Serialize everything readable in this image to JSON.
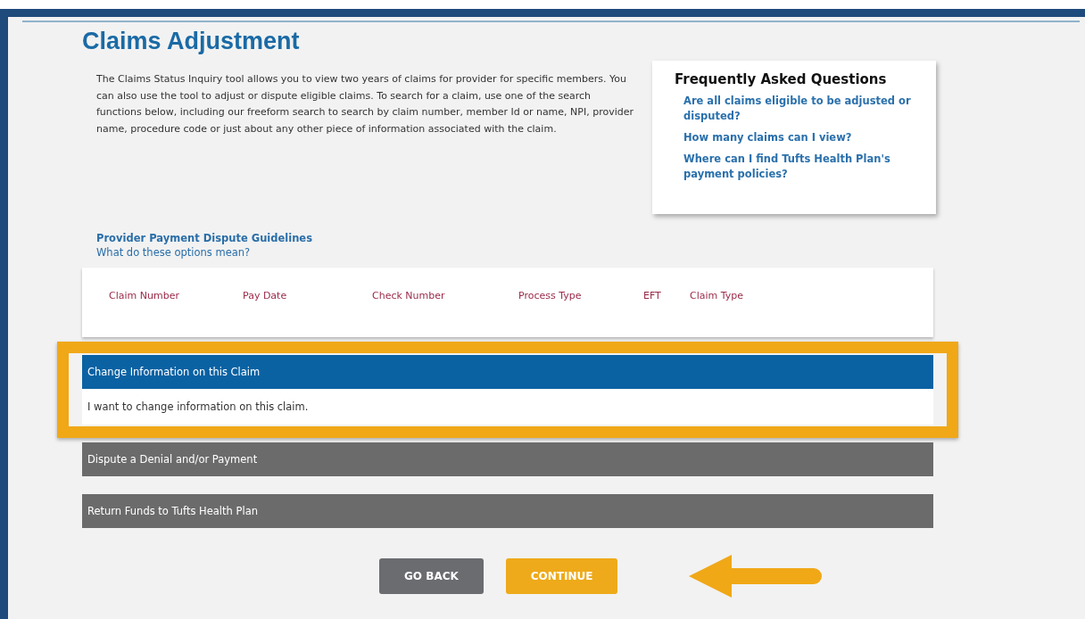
{
  "page": {
    "title": "Claims Adjustment",
    "intro": "The Claims Status Inquiry tool allows you to view two years of claims for provider for specific members. You can also use the tool to adjust or dispute eligible claims. To search for a claim, use one of the search functions below, including our freeform search to search by claim number, member Id or name, NPI, provider name, procedure code or just about any other piece of information associated with the claim."
  },
  "faq": {
    "title": "Frequently Asked Questions",
    "links": [
      "Are all claims eligible to be adjusted or disputed?",
      "How many claims can I view?",
      "Where can I find Tufts Health Plan's payment policies?"
    ]
  },
  "links": [
    "Provider Payment Dispute Guidelines",
    "What do these options mean?"
  ],
  "table": {
    "columns": [
      "Claim Number",
      "Pay Date",
      "Check Number",
      "Process Type",
      "EFT",
      "Claim Type"
    ]
  },
  "options": [
    {
      "title": "Change Information on this Claim",
      "description": "I want to change information on this claim.",
      "selected": true
    },
    {
      "title": "Dispute a Denial and/or Payment",
      "selected": false
    },
    {
      "title": "Return Funds to Tufts Health Plan",
      "selected": false
    }
  ],
  "buttons": [
    {
      "label": "GO BACK",
      "kind": "secondary"
    },
    {
      "label": "CONTINUE",
      "kind": "primary"
    }
  ]
}
